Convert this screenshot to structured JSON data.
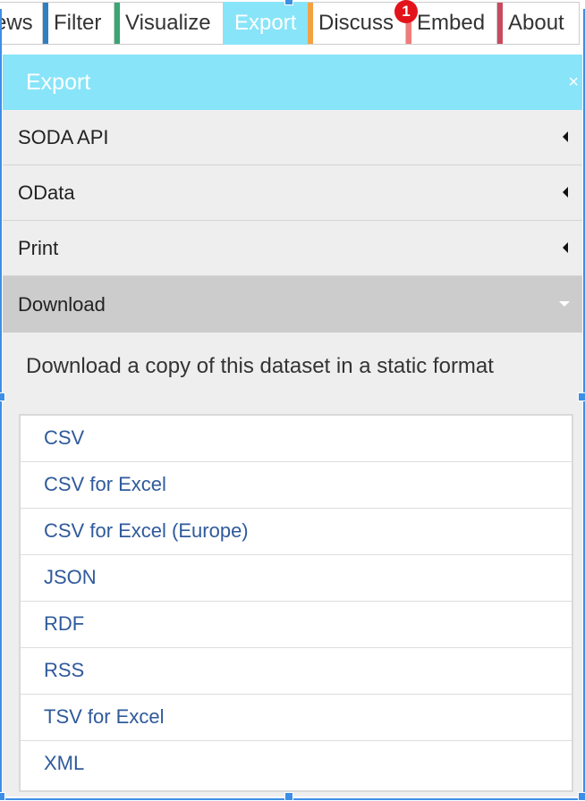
{
  "tabs": [
    {
      "key": "views",
      "label": "ews",
      "active": false,
      "strip_color": ""
    },
    {
      "key": "filter",
      "label": "Filter",
      "active": false,
      "strip_color": "#2f7fc1"
    },
    {
      "key": "visualize",
      "label": "Visualize",
      "active": false,
      "strip_color": "#3aa675"
    },
    {
      "key": "export",
      "label": "Export",
      "active": true,
      "strip_color": "#88e4f9"
    },
    {
      "key": "discuss",
      "label": "Discuss",
      "active": false,
      "strip_color": "#f2a243"
    },
    {
      "key": "embed",
      "label": "Embed",
      "active": false,
      "strip_color": "#f07b7b"
    },
    {
      "key": "about",
      "label": "About",
      "active": false,
      "strip_color": "#c9495e"
    }
  ],
  "discuss_badge": "1",
  "panel": {
    "title": "Export",
    "close_icon": "×",
    "sections": [
      {
        "key": "soda",
        "label": "SODA API",
        "expanded": false
      },
      {
        "key": "odata",
        "label": "OData",
        "expanded": false
      },
      {
        "key": "print",
        "label": "Print",
        "expanded": false
      },
      {
        "key": "download",
        "label": "Download",
        "expanded": true
      }
    ],
    "download": {
      "description": "Download a copy of this dataset in a static format",
      "formats": [
        "CSV",
        "CSV for Excel",
        "CSV for Excel (Europe)",
        "JSON",
        "RDF",
        "RSS",
        "TSV for Excel",
        "XML"
      ]
    }
  },
  "colors": {
    "accent": "#88e4f9",
    "link": "#2f5a9b",
    "badge": "#e3131b",
    "selection": "#3d8fe6"
  },
  "icons": {
    "collapsed": "arrow-left-icon",
    "expanded": "arrow-down-icon",
    "close": "close-icon"
  }
}
